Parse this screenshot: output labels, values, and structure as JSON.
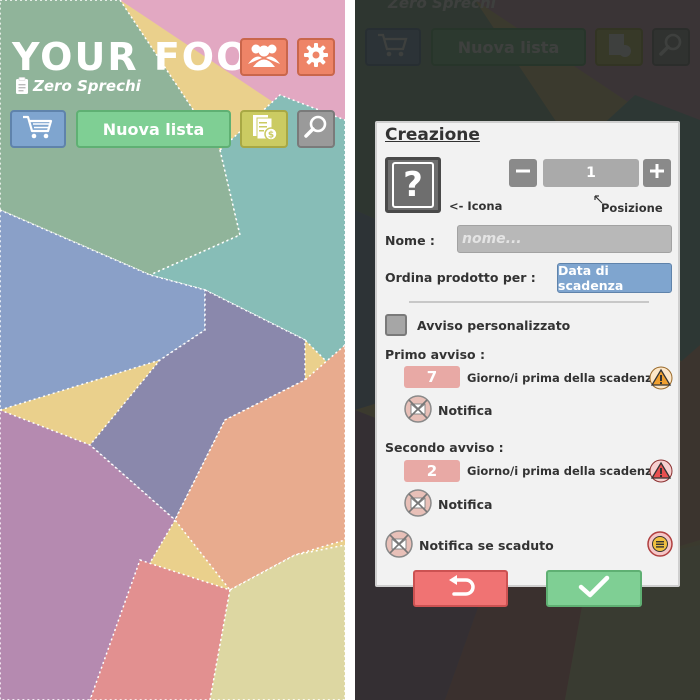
{
  "home": {
    "title": "YOUR FOOD",
    "subtitle": "Zero Sprechi",
    "new_list_label": "Nuova lista",
    "icons": {
      "users": "users-icon",
      "settings": "gear-icon",
      "cart": "cart-icon",
      "receipt": "receipt-icon",
      "search": "search-icon"
    },
    "colors": {
      "orange_button": "#ee8467",
      "blue_button": "#7fa5cf",
      "green_button": "#7fcf94",
      "yellow_button": "#cbcb62",
      "gray_button": "#9a9a9a"
    }
  },
  "dialog": {
    "title": "Creazione",
    "icon_placeholder": "?",
    "icon_caption": "<- Icona",
    "position_value": "1",
    "position_caption": "Posizione",
    "name_label": "Nome :",
    "name_placeholder": "nome...",
    "sort_label": "Ordina prodotto per :",
    "sort_value": "Data di scadenza",
    "custom_alert_label": "Avviso personalizzato",
    "first_alert_label": "Primo avviso :",
    "first_alert_days": "7",
    "days_before_label": "Giorno/i prima della scadenza",
    "notify_label": "Notifica",
    "second_alert_label": "Secondo avviso :",
    "second_alert_days": "2",
    "expired_notify_label": "Notifica se scaduto",
    "colors": {
      "cancel": "#f07373",
      "confirm": "#7fcf94",
      "sort_button": "#7fa5cf",
      "day_box": "#e8a9a5",
      "warning_orange": "#f0a030",
      "warning_red": "#e85050"
    }
  }
}
